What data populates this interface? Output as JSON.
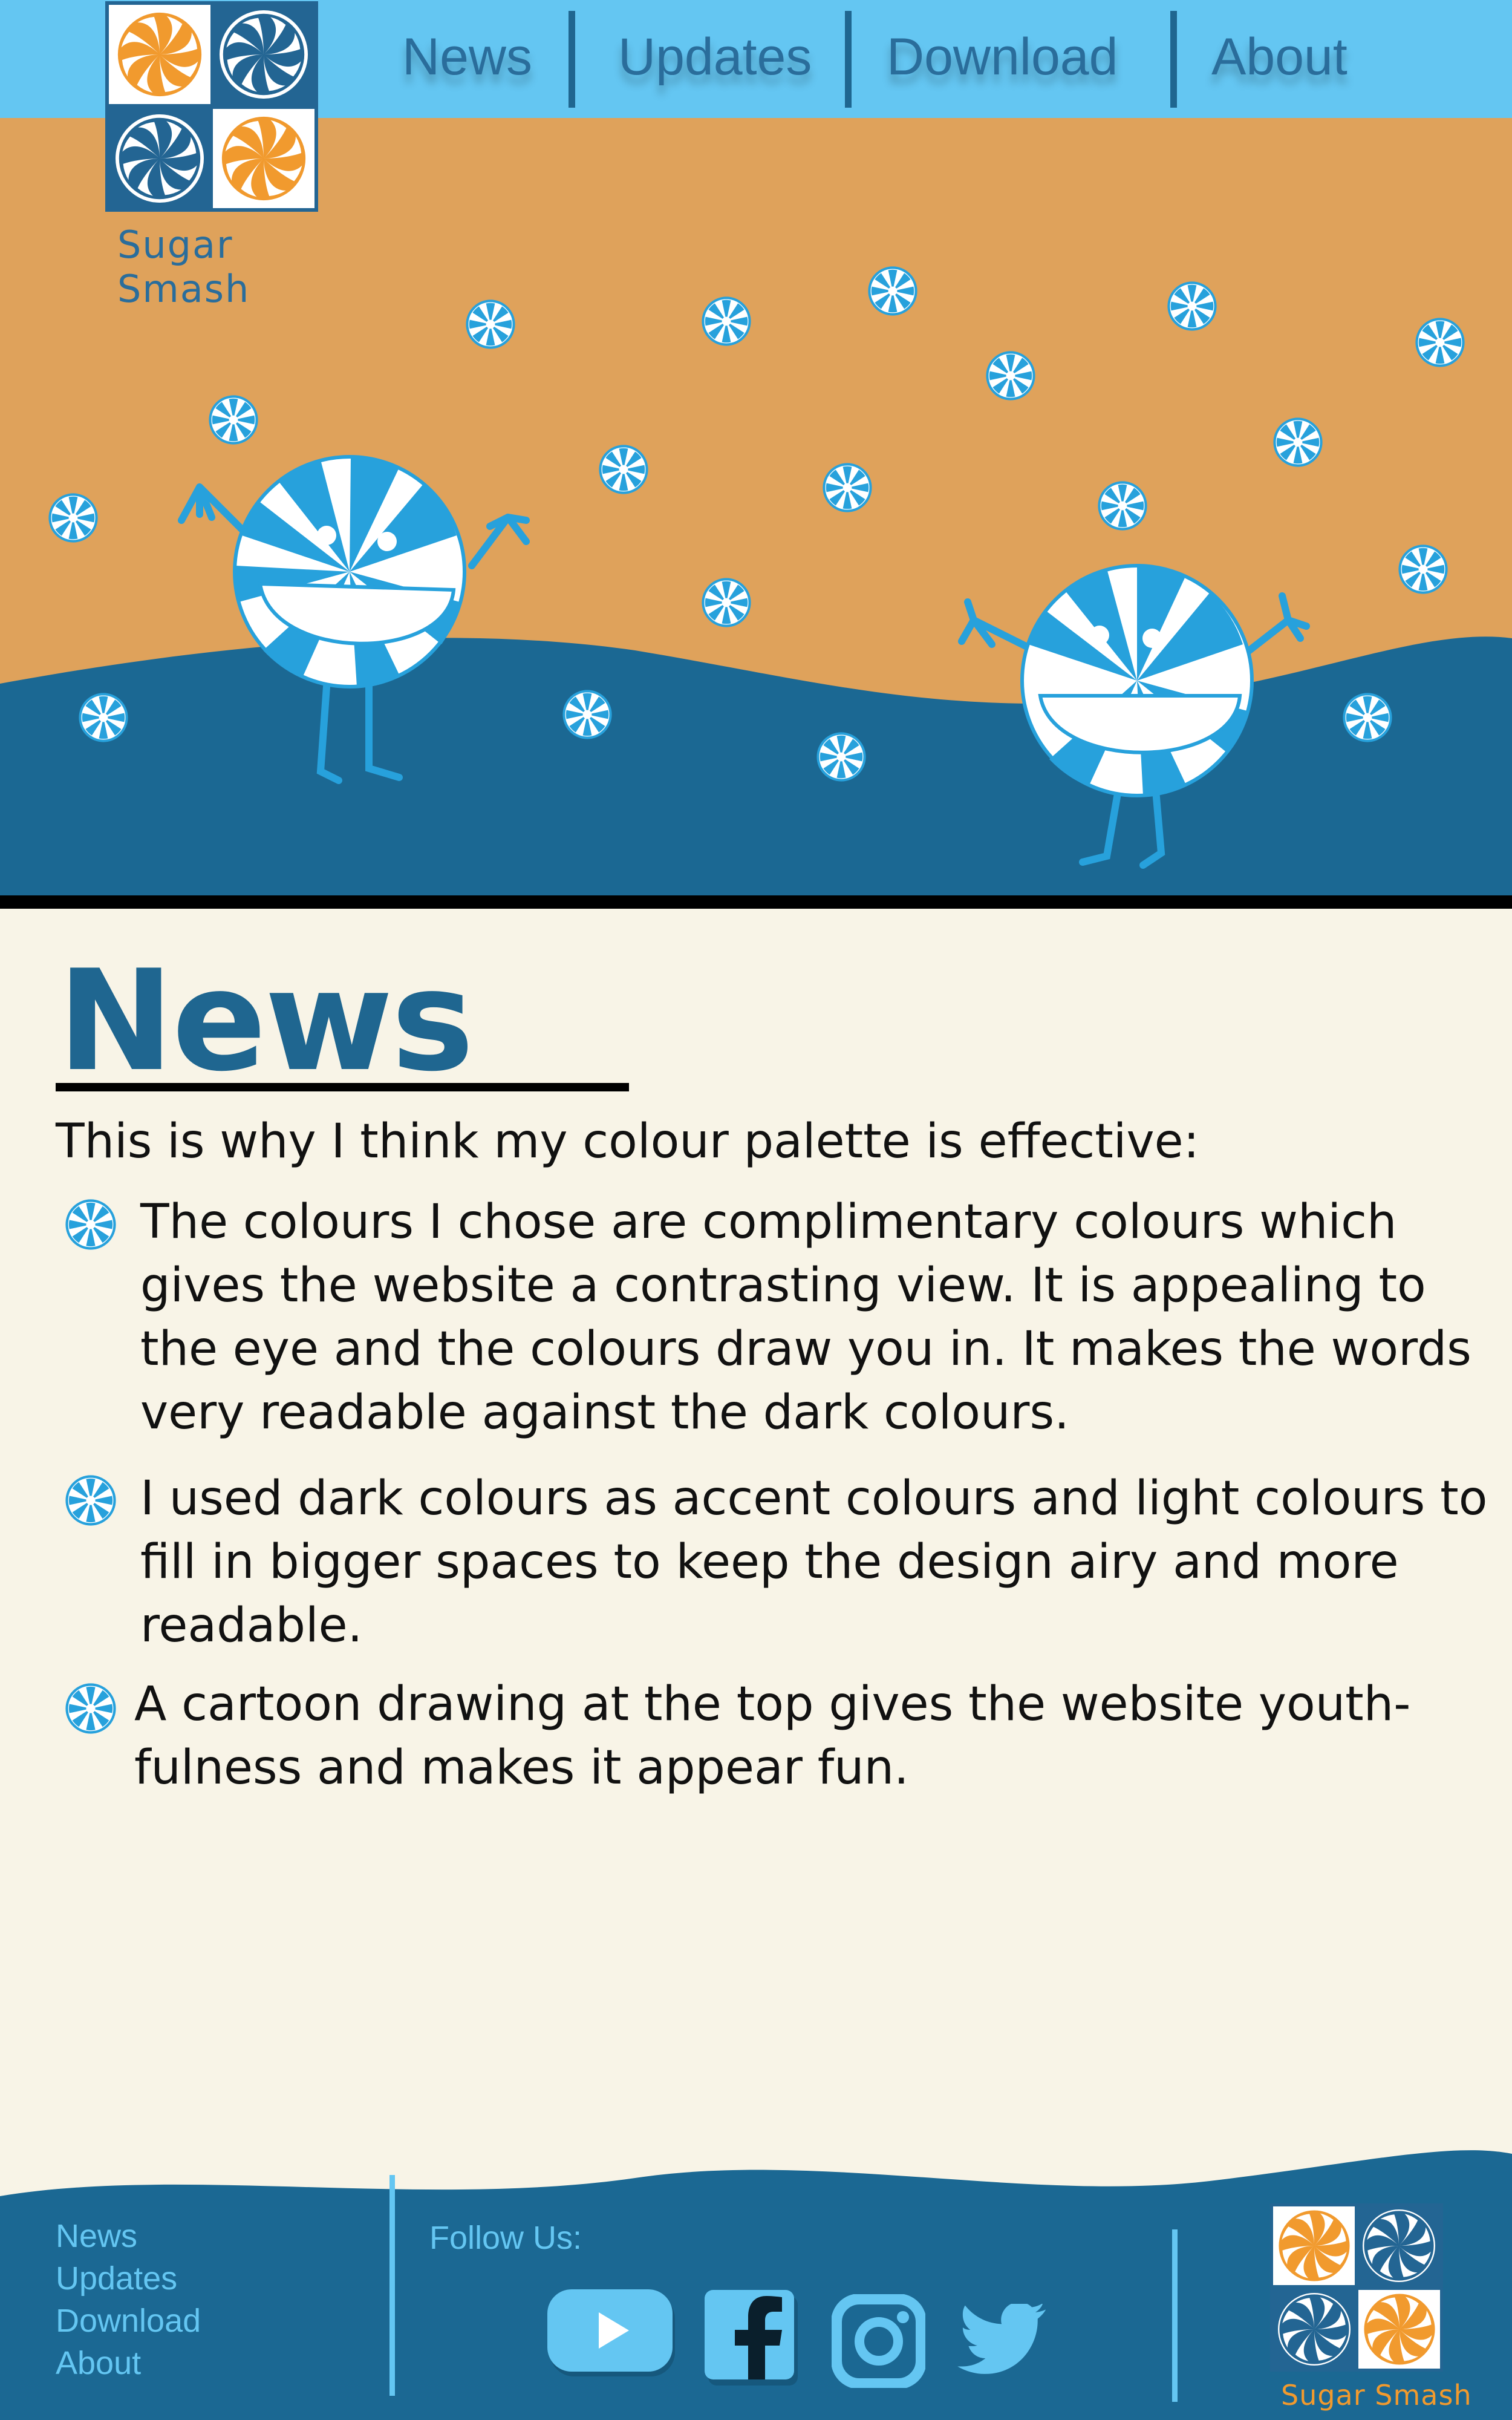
{
  "brand": {
    "name": "Sugar Smash"
  },
  "nav": {
    "items": [
      "News",
      "Updates",
      "Download",
      "About"
    ]
  },
  "news": {
    "title": "News",
    "intro": "This is why I think my colour palette is effective:",
    "bullets": [
      [
        "The colours I chose are complimentary colours which",
        "gives the website a contrasting view. It is appealing to",
        "the eye and the colours draw you in. It makes the words",
        "very readable against the dark colours."
      ],
      [
        "I used dark colours as accent colours and light colours to",
        "fill in bigger spaces to keep the design airy and more",
        "readable."
      ],
      [
        "A cartoon drawing at the top gives the website youth-",
        "fulness and makes it appear fun."
      ]
    ]
  },
  "footer": {
    "links": [
      "News",
      "Updates",
      "Download",
      "About"
    ],
    "follow_label": "Follow Us:",
    "social": [
      "youtube-icon",
      "facebook-icon",
      "instagram-icon",
      "twitter-icon"
    ]
  },
  "colors": {
    "nav_bg": "#64c6f2",
    "nav_text": "#2a6d9b",
    "sand": "#dfa25b",
    "hill": "#1b6893",
    "cream": "#f8f4e7",
    "candy_blue": "#27a1dc",
    "candy_orange": "#f19a2e",
    "title_blue": "#1f6690"
  }
}
